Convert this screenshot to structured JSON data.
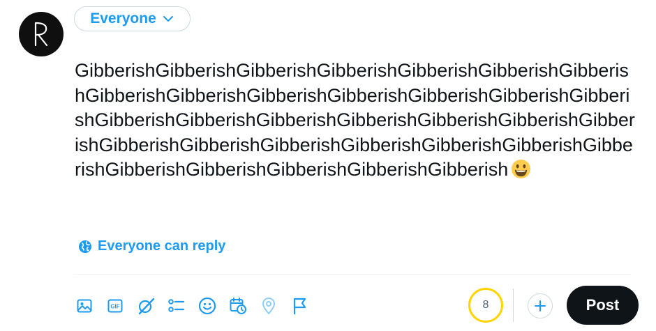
{
  "avatar": {
    "icon": "rk-logo-avatar"
  },
  "audience": {
    "label": "Everyone",
    "icon": "chevron-down-icon"
  },
  "composer": {
    "text": "GibberishGibberishGibberishGibberishGibberishGibberishGibberishGibberishGibberishGibberishGibberishGibberishGibberishGibberishGibberishGibberishGibberishGibberishGibberishGibberishGibberishGibberishGibberishGibberishGibberishGibberishGibberishGibberishGibberishGibberishGibberishGibberishGibberish",
    "emoji": "grinning-face-emoji"
  },
  "reply_setting": {
    "label": "Everyone can reply",
    "icon": "globe-icon"
  },
  "toolbar": {
    "tools": [
      "image-icon",
      "gif-icon",
      "grok-icon",
      "poll-icon",
      "emoji-icon",
      "schedule-icon",
      "location-icon",
      "flag-icon"
    ]
  },
  "counter": {
    "remaining": "8",
    "color": "#ffd400"
  },
  "post_button": {
    "label": "Post"
  },
  "colors": {
    "accent": "#1d9bf0",
    "text": "#0f1419",
    "post_bg": "#0f1419"
  }
}
